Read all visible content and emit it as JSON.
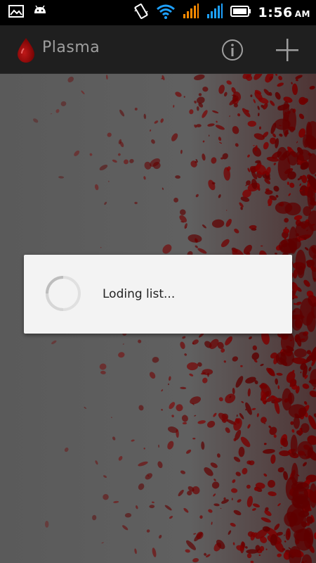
{
  "status_bar": {
    "time": "1:56",
    "ampm": "AM",
    "icons": [
      "gallery-notification-icon",
      "android-notification-icon",
      "vibrate-icon",
      "wifi-icon",
      "signal-icon-1",
      "signal-icon-2",
      "battery-icon"
    ]
  },
  "action_bar": {
    "title": "Plasma",
    "actions": [
      "info-icon",
      "add-icon"
    ]
  },
  "dialog": {
    "message": "Loding list..."
  },
  "colors": {
    "accent_red": "#8b0000",
    "signal_orange": "#ff8a00",
    "wifi_blue": "#1ea1ff",
    "background": "#5e5e5e"
  }
}
